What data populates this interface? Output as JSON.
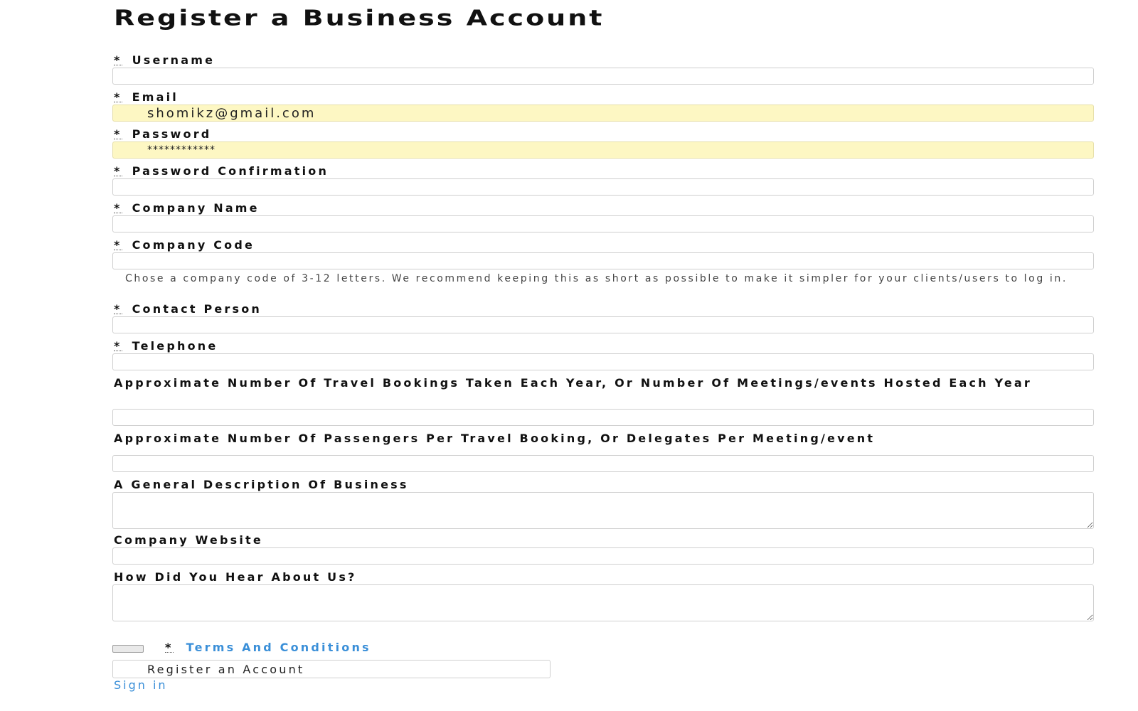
{
  "page": {
    "title": "Register a Business Account"
  },
  "form": {
    "required_marker": "*",
    "username": {
      "label": "Username",
      "value": ""
    },
    "email": {
      "label": "Email",
      "value": "shomikz@gmail.com"
    },
    "password": {
      "label": "Password",
      "value": "************"
    },
    "password_confirmation": {
      "label": "Password Confirmation",
      "value": ""
    },
    "company_name": {
      "label": "Company Name",
      "value": ""
    },
    "company_code": {
      "label": "Company Code",
      "value": "",
      "hint": "Chose a company code of 3-12 letters. We recommend keeping this as short as possible to make it simpler for your clients/users to log in."
    },
    "contact_person": {
      "label": "Contact Person",
      "value": ""
    },
    "telephone": {
      "label": "Telephone",
      "value": ""
    },
    "bookings_per_year": {
      "label": "Approximate Number Of Travel Bookings Taken Each Year, Or Number Of Meetings/events Hosted Each Year",
      "value": ""
    },
    "passengers_per_booking": {
      "label": "Approximate Number Of Passengers Per Travel Booking, Or Delegates Per Meeting/event",
      "value": ""
    },
    "business_description": {
      "label": "A General Description Of Business",
      "value": ""
    },
    "company_website": {
      "label": "Company Website",
      "value": ""
    },
    "hear_about_us": {
      "label": "How Did You Hear About Us?",
      "value": ""
    },
    "terms": {
      "label": "Terms And Conditions",
      "checked": false
    },
    "submit_label": "Register an Account",
    "signin_label": "Sign in"
  },
  "colors": {
    "autofill_background": "#fdf7c3",
    "link": "#3a8fd8",
    "border": "#cfcfcf"
  }
}
